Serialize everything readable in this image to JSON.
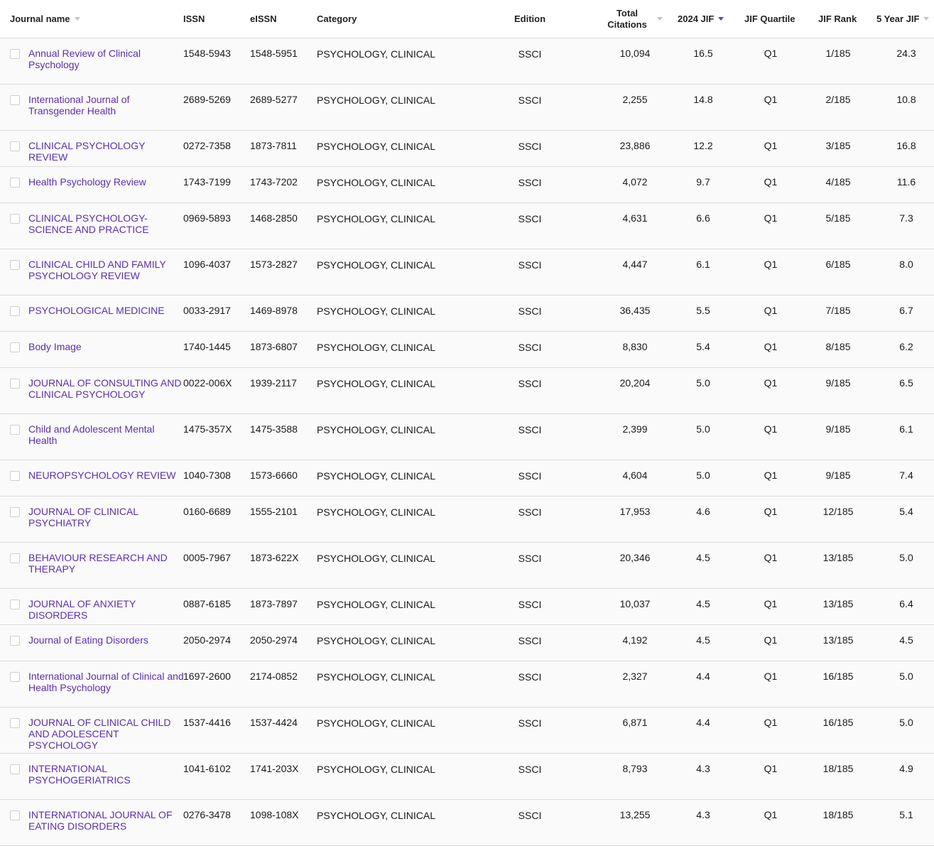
{
  "headers": {
    "journal_name": "Journal name",
    "issn": "ISSN",
    "eissn": "eISSN",
    "category": "Category",
    "edition": "Edition",
    "total_citations_line1": "Total",
    "total_citations_line2": "Citations",
    "jif_2024": "2024 JIF",
    "jif_quartile": "JIF Quartile",
    "jif_rank": "JIF Rank",
    "five_year_jif": "5 Year JIF"
  },
  "colors": {
    "link": "#5b2fb0",
    "active_sort": "#6a3dbb",
    "inactive_sort": "#c4c4c4"
  },
  "rows": [
    {
      "name": "Annual Review of Clinical Psychology",
      "issn": "1548-5943",
      "eissn": "1548-5951",
      "category": "PSYCHOLOGY, CLINICAL",
      "edition": "SSCI",
      "citations": "10,094",
      "jif": "16.5",
      "quartile": "Q1",
      "rank": "1/185",
      "jif5": "24.3"
    },
    {
      "name": "International Journal of Transgender Health",
      "issn": "2689-5269",
      "eissn": "2689-5277",
      "category": "PSYCHOLOGY, CLINICAL",
      "edition": "SSCI",
      "citations": "2,255",
      "jif": "14.8",
      "quartile": "Q1",
      "rank": "2/185",
      "jif5": "10.8"
    },
    {
      "name": "CLINICAL PSYCHOLOGY REVIEW",
      "issn": "0272-7358",
      "eissn": "1873-7811",
      "category": "PSYCHOLOGY, CLINICAL",
      "edition": "SSCI",
      "citations": "23,886",
      "jif": "12.2",
      "quartile": "Q1",
      "rank": "3/185",
      "jif5": "16.8"
    },
    {
      "name": "Health Psychology Review",
      "issn": "1743-7199",
      "eissn": "1743-7202",
      "category": "PSYCHOLOGY, CLINICAL",
      "edition": "SSCI",
      "citations": "4,072",
      "jif": "9.7",
      "quartile": "Q1",
      "rank": "4/185",
      "jif5": "11.6"
    },
    {
      "name": "CLINICAL PSYCHOLOGY-SCIENCE AND PRACTICE",
      "issn": "0969-5893",
      "eissn": "1468-2850",
      "category": "PSYCHOLOGY, CLINICAL",
      "edition": "SSCI",
      "citations": "4,631",
      "jif": "6.6",
      "quartile": "Q1",
      "rank": "5/185",
      "jif5": "7.3"
    },
    {
      "name": "CLINICAL CHILD AND FAMILY PSYCHOLOGY REVIEW",
      "issn": "1096-4037",
      "eissn": "1573-2827",
      "category": "PSYCHOLOGY, CLINICAL",
      "edition": "SSCI",
      "citations": "4,447",
      "jif": "6.1",
      "quartile": "Q1",
      "rank": "6/185",
      "jif5": "8.0"
    },
    {
      "name": "PSYCHOLOGICAL MEDICINE",
      "issn": "0033-2917",
      "eissn": "1469-8978",
      "category": "PSYCHOLOGY, CLINICAL",
      "edition": "SSCI",
      "citations": "36,435",
      "jif": "5.5",
      "quartile": "Q1",
      "rank": "7/185",
      "jif5": "6.7"
    },
    {
      "name": "Body Image",
      "issn": "1740-1445",
      "eissn": "1873-6807",
      "category": "PSYCHOLOGY, CLINICAL",
      "edition": "SSCI",
      "citations": "8,830",
      "jif": "5.4",
      "quartile": "Q1",
      "rank": "8/185",
      "jif5": "6.2"
    },
    {
      "name": "JOURNAL OF CONSULTING AND CLINICAL PSYCHOLOGY",
      "issn": "0022-006X",
      "eissn": "1939-2117",
      "category": "PSYCHOLOGY, CLINICAL",
      "edition": "SSCI",
      "citations": "20,204",
      "jif": "5.0",
      "quartile": "Q1",
      "rank": "9/185",
      "jif5": "6.5"
    },
    {
      "name": "Child and Adolescent Mental Health",
      "issn": "1475-357X",
      "eissn": "1475-3588",
      "category": "PSYCHOLOGY, CLINICAL",
      "edition": "SSCI",
      "citations": "2,399",
      "jif": "5.0",
      "quartile": "Q1",
      "rank": "9/185",
      "jif5": "6.1"
    },
    {
      "name": "NEUROPSYCHOLOGY REVIEW",
      "issn": "1040-7308",
      "eissn": "1573-6660",
      "category": "PSYCHOLOGY, CLINICAL",
      "edition": "SSCI",
      "citations": "4,604",
      "jif": "5.0",
      "quartile": "Q1",
      "rank": "9/185",
      "jif5": "7.4"
    },
    {
      "name": "JOURNAL OF CLINICAL PSYCHIATRY",
      "issn": "0160-6689",
      "eissn": "1555-2101",
      "category": "PSYCHOLOGY, CLINICAL",
      "edition": "SSCI",
      "citations": "17,953",
      "jif": "4.6",
      "quartile": "Q1",
      "rank": "12/185",
      "jif5": "5.4"
    },
    {
      "name": "BEHAVIOUR RESEARCH AND THERAPY",
      "issn": "0005-7967",
      "eissn": "1873-622X",
      "category": "PSYCHOLOGY, CLINICAL",
      "edition": "SSCI",
      "citations": "20,346",
      "jif": "4.5",
      "quartile": "Q1",
      "rank": "13/185",
      "jif5": "5.0"
    },
    {
      "name": "JOURNAL OF ANXIETY DISORDERS",
      "issn": "0887-6185",
      "eissn": "1873-7897",
      "category": "PSYCHOLOGY, CLINICAL",
      "edition": "SSCI",
      "citations": "10,037",
      "jif": "4.5",
      "quartile": "Q1",
      "rank": "13/185",
      "jif5": "6.4"
    },
    {
      "name": "Journal of Eating Disorders",
      "issn": "2050-2974",
      "eissn": "2050-2974",
      "category": "PSYCHOLOGY, CLINICAL",
      "edition": "SSCI",
      "citations": "4,192",
      "jif": "4.5",
      "quartile": "Q1",
      "rank": "13/185",
      "jif5": "4.5"
    },
    {
      "name": "International Journal of Clinical and Health Psychology",
      "issn": "1697-2600",
      "eissn": "2174-0852",
      "category": "PSYCHOLOGY, CLINICAL",
      "edition": "SSCI",
      "citations": "2,327",
      "jif": "4.4",
      "quartile": "Q1",
      "rank": "16/185",
      "jif5": "5.0"
    },
    {
      "name": "JOURNAL OF CLINICAL CHILD AND ADOLESCENT PSYCHOLOGY",
      "issn": "1537-4416",
      "eissn": "1537-4424",
      "category": "PSYCHOLOGY, CLINICAL",
      "edition": "SSCI",
      "citations": "6,871",
      "jif": "4.4",
      "quartile": "Q1",
      "rank": "16/185",
      "jif5": "5.0"
    },
    {
      "name": "INTERNATIONAL PSYCHOGERIATRICS",
      "issn": "1041-6102",
      "eissn": "1741-203X",
      "category": "PSYCHOLOGY, CLINICAL",
      "edition": "SSCI",
      "citations": "8,793",
      "jif": "4.3",
      "quartile": "Q1",
      "rank": "18/185",
      "jif5": "4.9"
    },
    {
      "name": "INTERNATIONAL JOURNAL OF EATING DISORDERS",
      "issn": "0276-3478",
      "eissn": "1098-108X",
      "category": "PSYCHOLOGY, CLINICAL",
      "edition": "SSCI",
      "citations": "13,255",
      "jif": "4.3",
      "quartile": "Q1",
      "rank": "18/185",
      "jif5": "5.1"
    }
  ]
}
